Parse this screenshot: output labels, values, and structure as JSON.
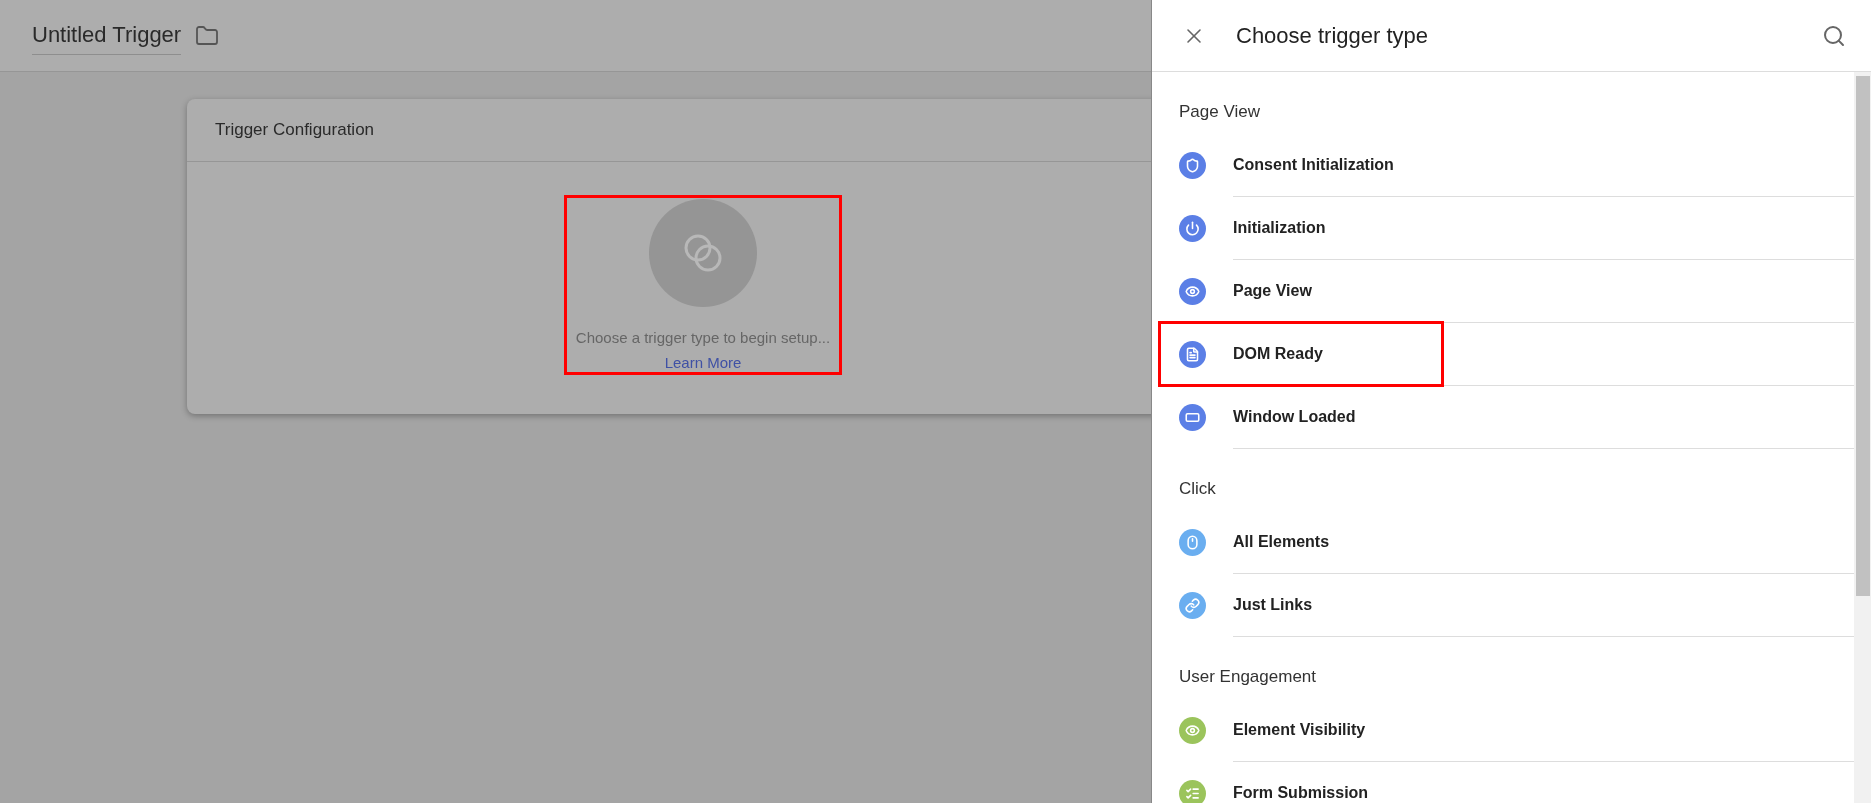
{
  "header": {
    "title": "Untitled Trigger"
  },
  "card": {
    "title": "Trigger Configuration",
    "empty_state": {
      "message": "Choose a trigger type to begin setup...",
      "link": "Learn More",
      "highlighted": true
    }
  },
  "panel": {
    "title": "Choose trigger type",
    "groups": [
      {
        "heading": "Page View",
        "items": [
          {
            "label": "Consent Initialization",
            "kind": "shield",
            "color": "#5b7fe6",
            "highlighted": false
          },
          {
            "label": "Initialization",
            "kind": "power",
            "color": "#5b7fe6",
            "highlighted": false
          },
          {
            "label": "Page View",
            "kind": "eye",
            "color": "#5b7fe6",
            "highlighted": false
          },
          {
            "label": "DOM Ready",
            "kind": "document",
            "color": "#5b7fe6",
            "highlighted": true
          },
          {
            "label": "Window Loaded",
            "kind": "window",
            "color": "#5b7fe6",
            "highlighted": false
          }
        ]
      },
      {
        "heading": "Click",
        "items": [
          {
            "label": "All Elements",
            "kind": "mouse",
            "color": "#6aaef0",
            "highlighted": false
          },
          {
            "label": "Just Links",
            "kind": "link",
            "color": "#6aaef0",
            "highlighted": false
          }
        ]
      },
      {
        "heading": "User Engagement",
        "items": [
          {
            "label": "Element Visibility",
            "kind": "eye",
            "color": "#9bc45c",
            "highlighted": false
          },
          {
            "label": "Form Submission",
            "kind": "form",
            "color": "#9bc45c",
            "highlighted": false
          }
        ]
      }
    ]
  }
}
